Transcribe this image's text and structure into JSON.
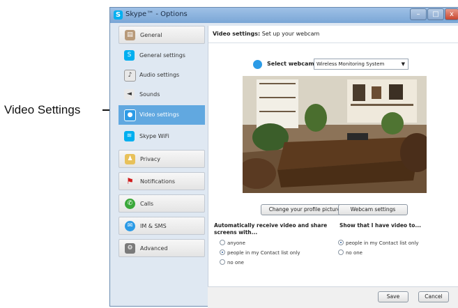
{
  "callout": {
    "label": "Video Settings"
  },
  "window": {
    "title": "Skype™ - Options",
    "min_glyph": "–",
    "max_glyph": "□",
    "close_glyph": "x"
  },
  "sidebar": {
    "items": [
      {
        "label": "General",
        "icon": "general-icon",
        "kind": "category"
      },
      {
        "label": "General settings",
        "icon": "skype-icon",
        "kind": "sub"
      },
      {
        "label": "Audio settings",
        "icon": "microphone-icon",
        "kind": "sub"
      },
      {
        "label": "Sounds",
        "icon": "speaker-icon",
        "kind": "sub"
      },
      {
        "label": "Video settings",
        "icon": "webcam-icon",
        "kind": "sub",
        "selected": true
      },
      {
        "label": "Skype WiFi",
        "icon": "wifi-icon",
        "kind": "sub"
      },
      {
        "label": "Privacy",
        "icon": "privacy-icon",
        "kind": "category"
      },
      {
        "label": "Notifications",
        "icon": "flag-icon",
        "kind": "category"
      },
      {
        "label": "Calls",
        "icon": "phone-icon",
        "kind": "category"
      },
      {
        "label": "IM & SMS",
        "icon": "chat-icon",
        "kind": "category"
      },
      {
        "label": "Advanced",
        "icon": "gear-icon",
        "kind": "category"
      }
    ]
  },
  "main": {
    "header_bold": "Video settings:",
    "header_rest": " Set up your webcam",
    "select_label": "Select webcam:",
    "webcam_value": "Wireless Monitoring System",
    "change_picture": "Change your profile picture",
    "webcam_settings": "Webcam settings",
    "receive_title": "Automatically receive video and share screens with...",
    "receive_options": [
      "anyone",
      "people in my Contact list only",
      "no one"
    ],
    "receive_selected": 1,
    "show_title": "Show that I have video to...",
    "show_options": [
      "people in my Contact list only",
      "no one"
    ],
    "show_selected": 0,
    "save": "Save",
    "cancel": "Cancel"
  },
  "colors": {
    "accent": "#61a8e0",
    "skype_blue": "#00aff0"
  }
}
